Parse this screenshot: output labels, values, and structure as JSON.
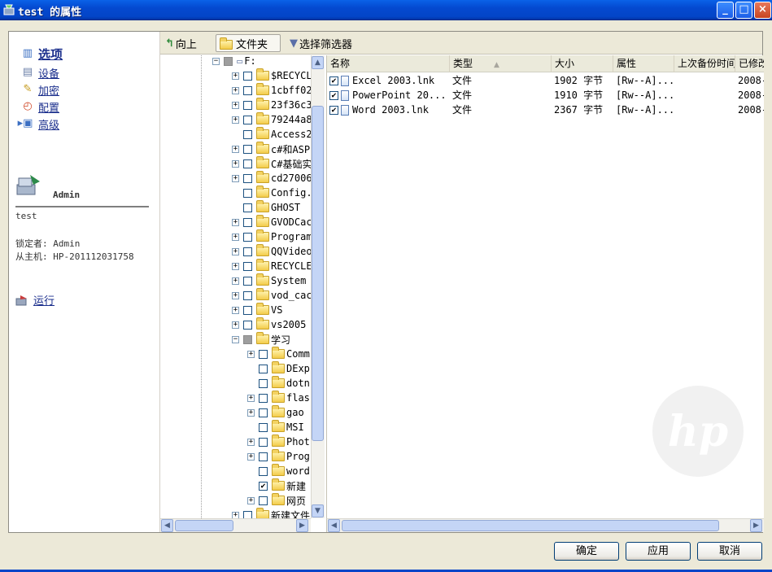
{
  "window": {
    "title": "test 的属性",
    "controls": [
      "_",
      "□",
      "×"
    ]
  },
  "nav": [
    {
      "label": "选项",
      "icon": "book-icon",
      "active": true
    },
    {
      "label": "设备",
      "icon": "device-icon",
      "active": false
    },
    {
      "label": "加密",
      "icon": "lock-icon",
      "active": false
    },
    {
      "label": "配置",
      "icon": "config-icon",
      "active": false
    },
    {
      "label": "高级",
      "icon": "advanced-icon",
      "active": false
    }
  ],
  "profile": {
    "user": "Admin",
    "name": "test",
    "locked_by": "锁定者: Admin",
    "host": "从主机: HP-201112031758"
  },
  "run": {
    "label": "运行"
  },
  "toolbar": {
    "up": "向上",
    "folders": "文件夹",
    "filter": "选择筛选器"
  },
  "tree": {
    "root": "F:",
    "items": [
      {
        "label": "$RECYCL",
        "expandable": true,
        "checked": false
      },
      {
        "label": "1cbff02",
        "expandable": true,
        "checked": false
      },
      {
        "label": "23f36c3",
        "expandable": true,
        "checked": false
      },
      {
        "label": "79244a8",
        "expandable": true,
        "checked": false
      },
      {
        "label": "Access2",
        "expandable": false,
        "checked": false
      },
      {
        "label": "c#和ASP",
        "expandable": true,
        "checked": false
      },
      {
        "label": "C#基础实",
        "expandable": true,
        "checked": false
      },
      {
        "label": "cd27006",
        "expandable": true,
        "checked": false
      },
      {
        "label": "Config.",
        "expandable": false,
        "checked": false
      },
      {
        "label": "GHOST",
        "expandable": false,
        "checked": false
      },
      {
        "label": "GVODCac",
        "expandable": true,
        "checked": false
      },
      {
        "label": "Program",
        "expandable": true,
        "checked": false
      },
      {
        "label": "QQVideo",
        "expandable": true,
        "checked": false
      },
      {
        "label": "RECYCLE",
        "expandable": true,
        "checked": false
      },
      {
        "label": "System",
        "expandable": true,
        "checked": false
      },
      {
        "label": "vod_cac",
        "expandable": true,
        "checked": false
      },
      {
        "label": "VS",
        "expandable": true,
        "checked": false
      },
      {
        "label": "vs2005",
        "expandable": true,
        "checked": false
      },
      {
        "label": "学习",
        "expandable": true,
        "expanded": true,
        "checked": "partial"
      },
      {
        "label": "Comm",
        "expandable": true,
        "checked": false,
        "child": true
      },
      {
        "label": "DExp",
        "expandable": false,
        "checked": false,
        "child": true
      },
      {
        "label": "dotn",
        "expandable": false,
        "checked": false,
        "child": true
      },
      {
        "label": "flas",
        "expandable": true,
        "checked": false,
        "child": true
      },
      {
        "label": "gao",
        "expandable": true,
        "checked": false,
        "child": true
      },
      {
        "label": "MSI",
        "expandable": false,
        "checked": false,
        "child": true
      },
      {
        "label": "Phot",
        "expandable": true,
        "checked": false,
        "child": true
      },
      {
        "label": "Prog",
        "expandable": true,
        "checked": false,
        "child": true
      },
      {
        "label": "word",
        "expandable": false,
        "checked": false,
        "child": true
      },
      {
        "label": "新建",
        "expandable": false,
        "checked": true,
        "child": true
      },
      {
        "label": "网页",
        "expandable": true,
        "checked": false,
        "child": true
      },
      {
        "label": "新建文件",
        "expandable": true,
        "checked": false
      }
    ]
  },
  "list": {
    "columns": [
      "名称",
      "类型",
      "大小",
      "属性",
      "上次备份时间",
      "已修改"
    ],
    "rows": [
      {
        "name": "Excel 2003.lnk",
        "type": "文件",
        "size": "1902 字节",
        "attr": "[Rw--A]...",
        "backup": "",
        "modified": "2008-"
      },
      {
        "name": "PowerPoint 20...",
        "type": "文件",
        "size": "1910 字节",
        "attr": "[Rw--A]...",
        "backup": "",
        "modified": "2008-"
      },
      {
        "name": "Word 2003.lnk",
        "type": "文件",
        "size": "2367 字节",
        "attr": "[Rw--A]...",
        "backup": "",
        "modified": "2008-"
      }
    ]
  },
  "buttons": {
    "ok": "确定",
    "apply": "应用",
    "cancel": "取消"
  },
  "logo": {
    "text": "hp"
  }
}
